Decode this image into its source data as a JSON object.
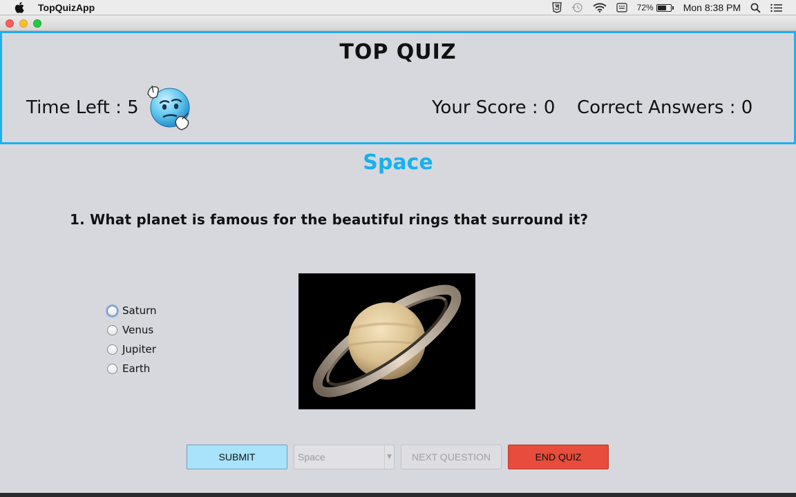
{
  "menubar": {
    "app_name": "TopQuizApp",
    "battery_percent": "72%",
    "battery_level": 0.72,
    "clock": "Mon 8:38 PM",
    "status_icons": [
      "html5-icon",
      "time-machine-icon",
      "wifi-icon",
      "keyboard-input-icon",
      "battery-icon",
      "spotlight-search-icon",
      "notification-center-icon"
    ]
  },
  "header": {
    "title": "TOP QUIZ",
    "time_left": "Time Left : 5",
    "score": "Your Score : 0",
    "correct_answers": "Correct Answers : 0",
    "emoji": "thinking-emoji"
  },
  "quiz": {
    "category": "Space",
    "question": "1. What planet is famous for the beautiful rings that surround it?",
    "options": [
      "Saturn",
      "Venus",
      "Jupiter",
      "Earth"
    ],
    "image": "saturn-image"
  },
  "controls": {
    "submit": "SUBMIT",
    "category_select": "Space",
    "next_question": "NEXT QUESTION",
    "end_quiz": "END QUIZ"
  },
  "colors": {
    "accent": "#1bb1ef",
    "category_text": "#17b1ef",
    "submit_bg": "#a8e3fb",
    "end_bg": "#e74c3c",
    "background": "#d7d8de"
  }
}
